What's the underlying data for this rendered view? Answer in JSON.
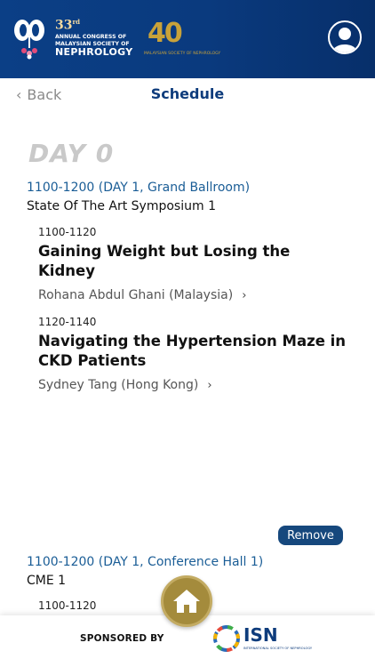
{
  "header": {
    "congress_number": "33",
    "congress_suffix": "rd",
    "congress_line1": "ANNUAL CONGRESS OF",
    "congress_line2": "MALAYSIAN SOCIETY OF",
    "congress_line3": "NEPHROLOGY",
    "anniversary_number": "40",
    "anniversary_sub": "MALAYSIAN SOCIETY OF NEPHROLOGY",
    "profile_icon": "user-circle-icon"
  },
  "nav": {
    "back_label": "Back",
    "title": "Schedule"
  },
  "day_label": "DAY 0",
  "sessions": [
    {
      "time": "1100-1200 (DAY 1, Grand Ballroom)",
      "name": "State Of The Art Symposium 1",
      "talks": [
        {
          "time": "1100-1120",
          "title": "Gaining Weight but Losing the Kidney",
          "speaker": "Rohana Abdul Ghani (Malaysia)"
        },
        {
          "time": "1120-1140",
          "title": "Navigating the Hypertension Maze in CKD Patients",
          "speaker": "Sydney Tang (Hong Kong)"
        }
      ]
    },
    {
      "time": "1100-1200 (DAY 1, Conference Hall 1)",
      "name": "CME 1",
      "remove_label": "Remove",
      "talks": [
        {
          "time": "1100-1120"
        }
      ]
    }
  ],
  "footer": {
    "sponsored_label": "SPONSORED BY",
    "sponsor_name": "ISN",
    "sponsor_sub": "INTERNATIONAL SOCIETY OF NEPHROLOGY"
  },
  "colors": {
    "header_bg": "#0b3f86",
    "accent_blue": "#1a5d96",
    "title_blue": "#0e3c7c",
    "gold": "#a48b3c",
    "day_gray": "#c9c9c9"
  }
}
